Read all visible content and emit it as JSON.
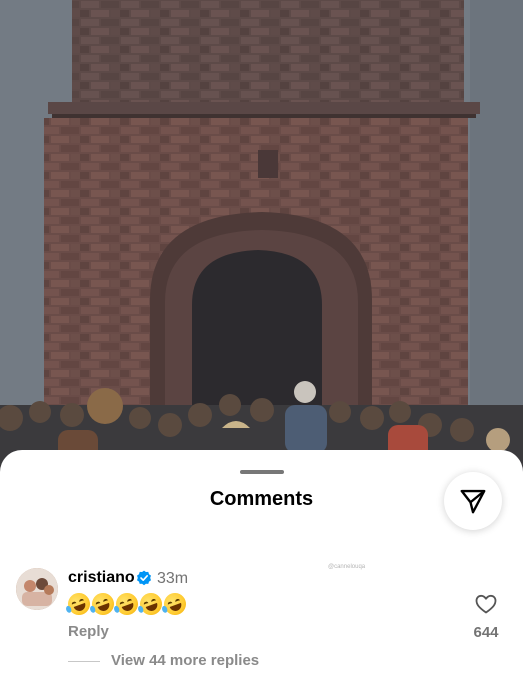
{
  "sheet": {
    "title": "Comments",
    "watermark": "@cannelouqa"
  },
  "comment": {
    "username": "cristiano",
    "verified": true,
    "time": "33m",
    "emoji": "rolling-on-floor-laughing",
    "emoji_count": 5,
    "reply_label": "Reply",
    "like_count": "644",
    "view_replies": "View 44 more replies"
  },
  "icons": {
    "share": "paper-plane-icon",
    "like": "heart-outline-icon",
    "verified": "verified-badge-icon"
  },
  "colors": {
    "verified_blue": "#0095f6",
    "secondary_text": "#737373"
  }
}
